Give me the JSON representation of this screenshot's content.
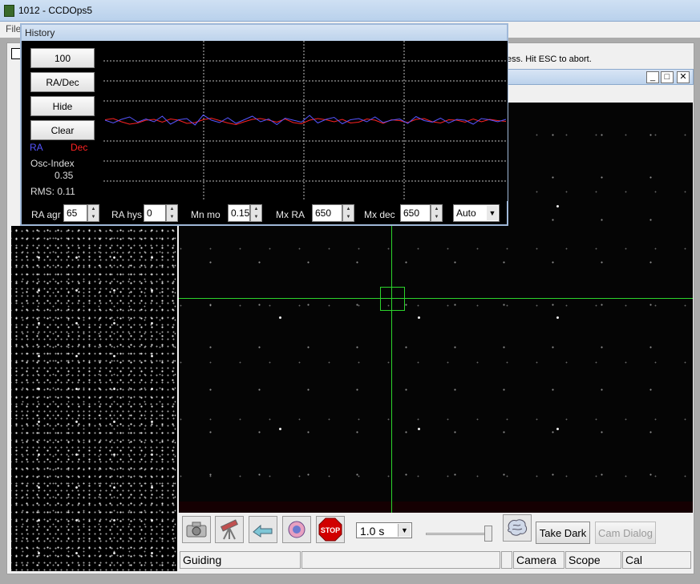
{
  "app": {
    "title": "1012 - CCDOps5",
    "menu_file": "File"
  },
  "status_message": "ess.  Hit ESC to abort.",
  "inner_window_buttons": {
    "minimize": "_",
    "maximize": "□",
    "close": "✕"
  },
  "history": {
    "title": "History",
    "buttons": {
      "scale": "100",
      "mode": "RA/Dec",
      "hide": "Hide",
      "clear": "Clear"
    },
    "legend": {
      "ra": "RA",
      "dec": "Dec",
      "ra_color": "#5555ff",
      "dec_color": "#ff2222"
    },
    "osc_index_label": "Osc-Index",
    "osc_index_value": "0.35",
    "rms_text": "RMS: 0.11",
    "controls": {
      "ra_agr": {
        "label": "RA agr",
        "value": "65"
      },
      "ra_hys": {
        "label": "RA hys",
        "value": "0"
      },
      "mn_mo": {
        "label": "Mn mo",
        "value": "0.15"
      },
      "mx_ra": {
        "label": "Mx RA",
        "value": "650"
      },
      "mx_dec": {
        "label": "Mx dec",
        "value": "650"
      },
      "mode_select": "Auto"
    },
    "graph": {
      "ra_series": [
        0.02,
        -0.05,
        0.04,
        0.1,
        -0.03,
        0.05,
        -0.02,
        0.12,
        -0.08,
        0.03,
        0.06,
        -0.1,
        0.15,
        0.02,
        -0.04,
        0.08,
        -0.06,
        0.03,
        0.12,
        -0.02,
        0.05,
        -0.09,
        0.07,
        0.02,
        -0.03,
        0.14,
        -0.05,
        0.04,
        0.09,
        -0.07,
        0.03,
        0.06,
        -0.02,
        0.1,
        -0.04,
        0.02,
        0.05,
        -0.06,
        0.11,
        0.01,
        -0.03,
        0.07,
        -0.05,
        0.04,
        0.02,
        -0.08,
        0.06,
        0.03,
        -0.02,
        0.04
      ],
      "dec_series": [
        0.03,
        0.06,
        -0.02,
        -0.08,
        -0.05,
        0.02,
        0.04,
        -0.03,
        0.05,
        0.02,
        -0.06,
        -0.04,
        0.03,
        0.07,
        0.01,
        -0.05,
        -0.09,
        -0.02,
        0.04,
        0.06,
        0.02,
        -0.03,
        0.05,
        -0.04,
        -0.07,
        0.02,
        0.06,
        0.03,
        -0.02,
        0.04,
        -0.05,
        -0.03,
        0.05,
        0.02,
        -0.06,
        0.03,
        0.01,
        -0.04,
        0.04,
        0.06,
        -0.02,
        -0.05,
        0.03,
        0.02,
        -0.03,
        0.05,
        -0.02,
        0.04,
        0.01,
        -0.01
      ]
    }
  },
  "toolbar": {
    "exposure": "1.0 s",
    "take_dark": "Take Dark",
    "cam_dialog": "Cam Dialog",
    "stop_label": "STOP"
  },
  "statusbar": {
    "guiding": "Guiding",
    "camera": "Camera",
    "scope": "Scope",
    "cal": "Cal"
  },
  "colors": {
    "crosshair": "#2cd42c"
  }
}
